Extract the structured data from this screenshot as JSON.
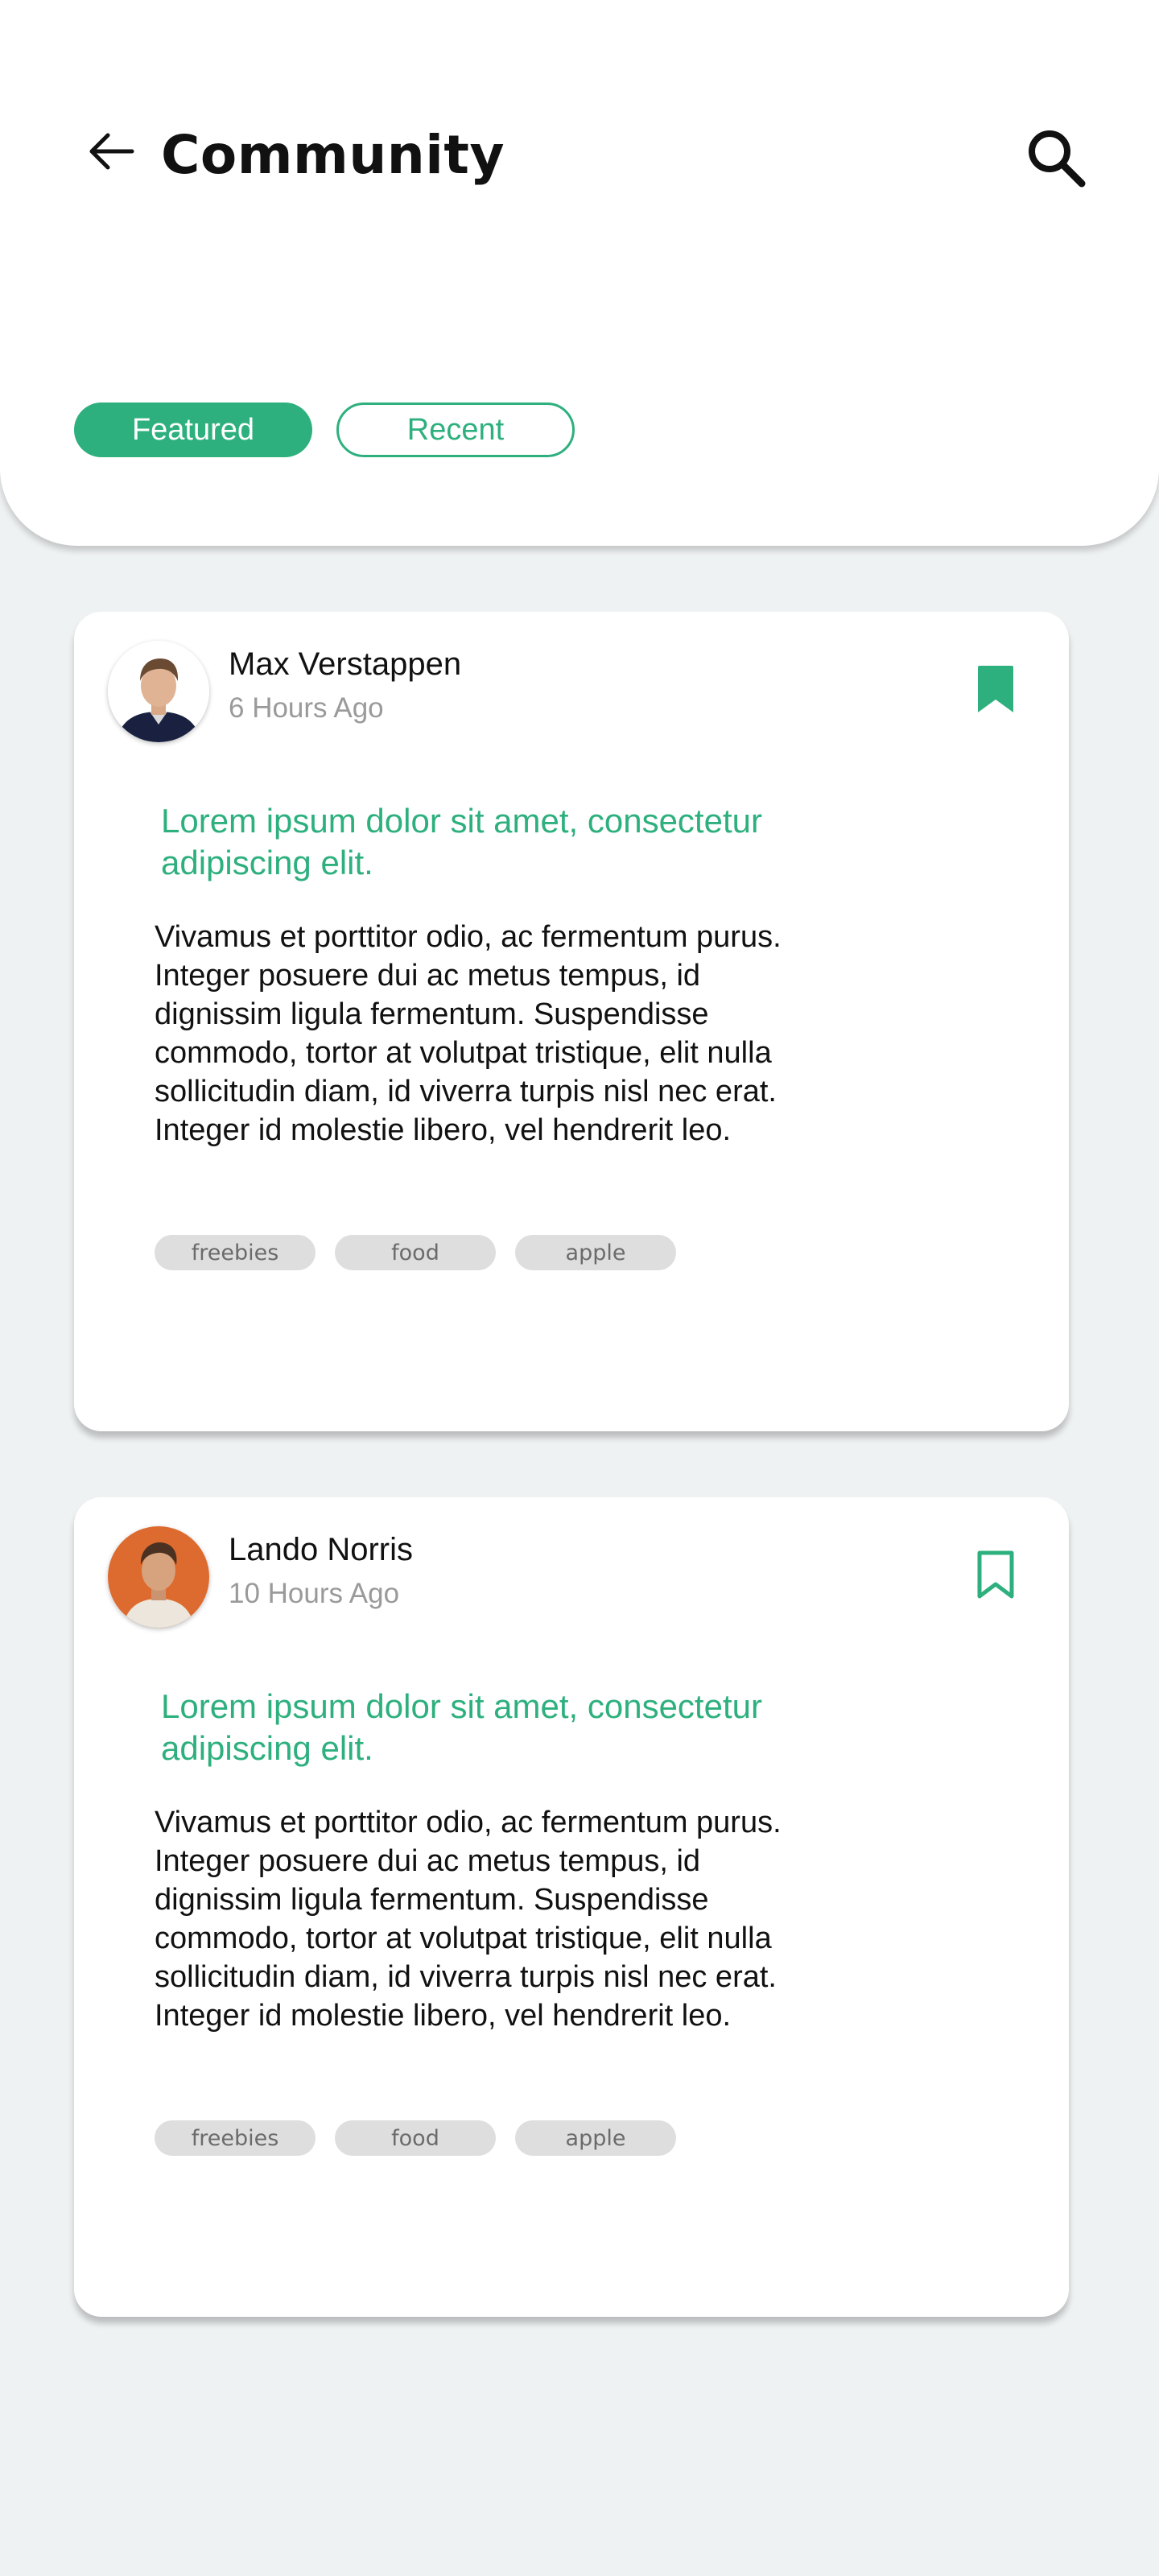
{
  "header": {
    "title": "Community",
    "back_icon": "arrow-left-icon",
    "search_icon": "search-icon"
  },
  "tabs": [
    {
      "label": "Featured",
      "active": true
    },
    {
      "label": "Recent",
      "active": false
    }
  ],
  "colors": {
    "accent": "#2eb07e",
    "background": "#eff2f3",
    "tag_background": "#dedede",
    "muted_text": "#9a9a9a"
  },
  "posts": [
    {
      "author": "Max Verstappen",
      "time": "6 Hours Ago",
      "bookmarked": true,
      "bookmark_icon": "bookmark-filled-icon",
      "headline": "Lorem ipsum dolor sit amet, consectetur adipiscing elit.",
      "body": "Vivamus et porttitor odio, ac fermentum purus. Integer posuere dui ac metus tempus, id dignissim ligula fermentum. Suspendisse commodo, tortor at volutpat tristique, elit nulla sollicitudin diam, id viverra turpis nisl nec erat. Integer id molestie libero, vel hendrerit leo.",
      "tags": [
        "freebies",
        "food",
        "apple"
      ]
    },
    {
      "author": "Lando Norris",
      "time": "10 Hours Ago",
      "bookmarked": false,
      "bookmark_icon": "bookmark-outline-icon",
      "headline": "Lorem ipsum dolor sit amet, consectetur adipiscing elit.",
      "body": "Vivamus et porttitor odio, ac fermentum purus. Integer posuere dui ac metus tempus, id dignissim ligula fermentum. Suspendisse commodo, tortor at volutpat tristique, elit nulla sollicitudin diam, id viverra turpis nisl nec erat. Integer id molestie libero, vel hendrerit leo.",
      "tags": [
        "freebies",
        "food",
        "apple"
      ]
    }
  ]
}
